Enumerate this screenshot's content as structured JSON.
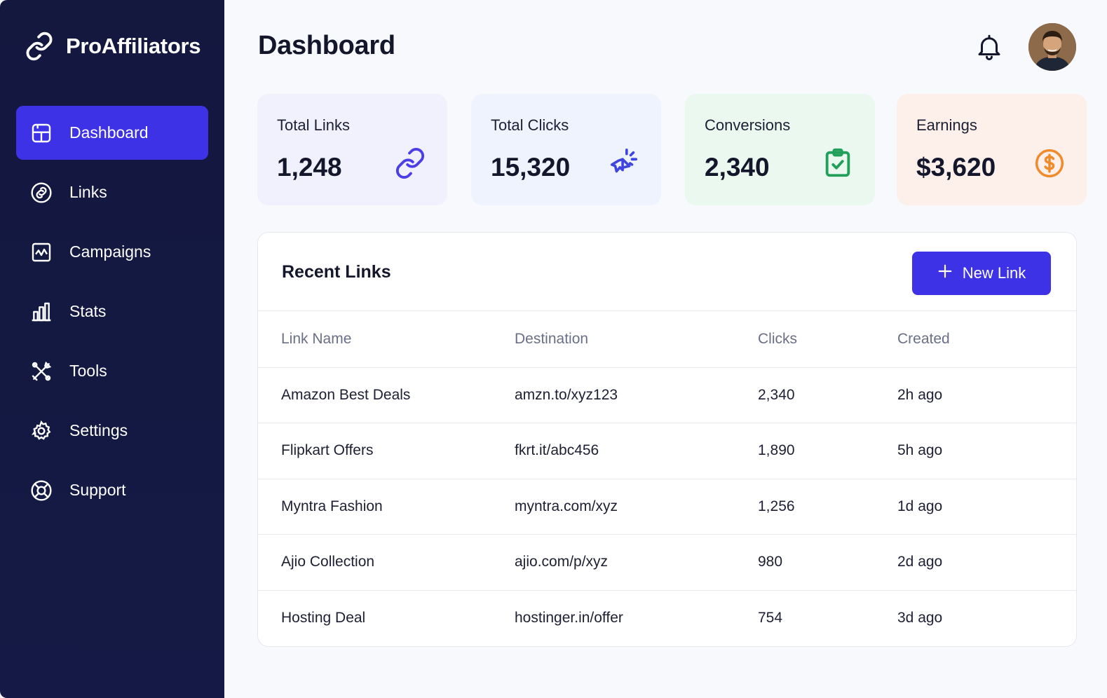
{
  "app": {
    "name": "ProAffiliators"
  },
  "sidebar": {
    "items": [
      {
        "label": "Dashboard",
        "icon": "dashboard-icon",
        "active": true
      },
      {
        "label": "Links",
        "icon": "link-icon",
        "active": false
      },
      {
        "label": "Campaigns",
        "icon": "campaigns-icon",
        "active": false
      },
      {
        "label": "Stats",
        "icon": "stats-icon",
        "active": false
      },
      {
        "label": "Tools",
        "icon": "tools-icon",
        "active": false
      },
      {
        "label": "Settings",
        "icon": "gear-icon",
        "active": false
      },
      {
        "label": "Support",
        "icon": "support-icon",
        "active": false
      }
    ]
  },
  "header": {
    "title": "Dashboard",
    "bell_icon": "bell-icon",
    "avatar": "user-avatar"
  },
  "stats": [
    {
      "label": "Total Links",
      "value": "1,248",
      "icon": "link-icon",
      "bg": "#f1f0fd",
      "accent": "#4b3ee8"
    },
    {
      "label": "Total Clicks",
      "value": "15,320",
      "icon": "click-icon",
      "bg": "#eef3fe",
      "accent": "#3f46e0"
    },
    {
      "label": "Conversions",
      "value": "2,340",
      "icon": "clipboard-check-icon",
      "bg": "#eaf8ef",
      "accent": "#22a05a"
    },
    {
      "label": "Earnings",
      "value": "$3,620",
      "icon": "dollar-coin-icon",
      "bg": "#fdf0eb",
      "accent": "#f08a2a"
    }
  ],
  "recent_links": {
    "title": "Recent Links",
    "new_button": "New Link",
    "columns": [
      "Link Name",
      "Destination",
      "Clicks",
      "Created"
    ],
    "rows": [
      [
        "Amazon Best Deals",
        "amzn.to/xyz123",
        "2,340",
        "2h ago"
      ],
      [
        "Flipkart Offers",
        "fkrt.it/abc456",
        "1,890",
        "5h ago"
      ],
      [
        "Myntra Fashion",
        "myntra.com/xyz",
        "1,256",
        "1d ago"
      ],
      [
        "Ajio Collection",
        "ajio.com/p/xyz",
        "980",
        "2d ago"
      ],
      [
        "Hosting Deal",
        "hostinger.in/offer",
        "754",
        "3d ago"
      ]
    ]
  },
  "colors": {
    "sidebar": "#14183f",
    "primary": "#3e32e6"
  }
}
